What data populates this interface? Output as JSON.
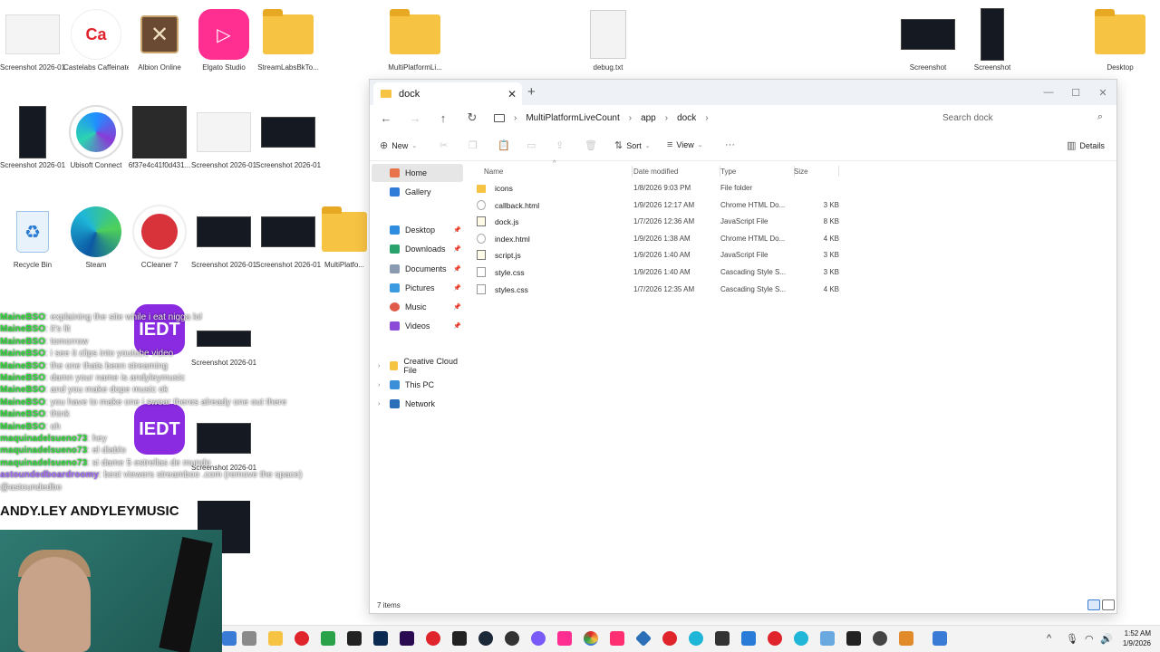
{
  "desktop": {
    "icons": [
      {
        "label": "Screenshot 2026-01 ...",
        "kind": "shot-light"
      },
      {
        "label": "Castelabs Caffeinated",
        "kind": "castelabs"
      },
      {
        "label": "Albion Online",
        "kind": "albion"
      },
      {
        "label": "Elgato Studio",
        "kind": "elgato"
      },
      {
        "label": "StreamLabsBkTo...",
        "kind": "folder"
      },
      {
        "label": "MultiPlatformLi...",
        "kind": "folder"
      },
      {
        "label": "debug.txt",
        "kind": "doc"
      },
      {
        "label": "Screenshot",
        "kind": "shot-dark"
      },
      {
        "label": "Screenshot",
        "kind": "shot-tall"
      },
      {
        "label": "Desktop",
        "kind": "folder"
      },
      {
        "label": "Screenshot 2026-01 ...",
        "kind": "shot-tall"
      },
      {
        "label": "Ubisoft Connect",
        "kind": "ubisoft"
      },
      {
        "label": "6f37e4c41f0d431...",
        "kind": "photo"
      },
      {
        "label": "Screenshot 2026-01 ...",
        "kind": "shot-light"
      },
      {
        "label": "Screenshot 2026-01 ...",
        "kind": "shot-dark"
      },
      {
        "label": "Recycle Bin",
        "kind": "recycle"
      },
      {
        "label": "Steam",
        "kind": "edge"
      },
      {
        "label": "CCleaner 7",
        "kind": "ccleaner"
      },
      {
        "label": "Screenshot 2026-01 ...",
        "kind": "shot-dark"
      },
      {
        "label": "Screenshot 2026-01 ...",
        "kind": "shot-dark"
      },
      {
        "label": "MultiPlatfo...",
        "kind": "folder"
      },
      {
        "label": "IEDT",
        "kind": "iedt"
      },
      {
        "label": "Screenshot 2026-01 ...",
        "kind": "shot-dark"
      },
      {
        "label": "IEDT",
        "kind": "iedt"
      },
      {
        "label": "Screenshot 2026-01 ...",
        "kind": "shot-dark"
      }
    ]
  },
  "chat": [
    {
      "user": "MaineBSO",
      "msg": "explaining the site while i eat nigga lol",
      "color": "green"
    },
    {
      "user": "MaineBSO",
      "msg": "it's lit",
      "color": "green"
    },
    {
      "user": "MaineBSO",
      "msg": "tomorrow",
      "color": "green"
    },
    {
      "user": "MaineBSO",
      "msg": "i see it clips into youtube video",
      "color": "green"
    },
    {
      "user": "MaineBSO",
      "msg": "the one thats been streaming",
      "color": "green"
    },
    {
      "user": "MaineBSO",
      "msg": "damn your name is andyleymusic",
      "color": "green"
    },
    {
      "user": "MaineBSO",
      "msg": "and you make dope music ok",
      "color": "green"
    },
    {
      "user": "MaineBSO",
      "msg": "you have to make one i swear theres already one out there",
      "color": "green"
    },
    {
      "user": "MaineBSO",
      "msg": "think",
      "color": "green"
    },
    {
      "user": "MaineBSO",
      "msg": "oh",
      "color": "green"
    },
    {
      "user": "maquinadelsueno73",
      "msg": "hey",
      "color": "green"
    },
    {
      "user": "maquinadelsueno73",
      "msg": "el diablo",
      "color": "green"
    },
    {
      "user": "maquinadelsueno73",
      "msg": "si dame 5 estrellas de mundo",
      "color": "green"
    },
    {
      "user": "astoundedboardroomy",
      "msg": "best viewers streamboo .com (remove the space)",
      "color": "purple"
    },
    {
      "user": "",
      "msg": "@astoundedbo",
      "color": "grey"
    }
  ],
  "promo": "ANDY.LEY   ANDYLEYMUSIC",
  "explorer": {
    "tab_title": "dock",
    "breadcrumb": [
      "MultiPlatformLiveCount",
      "app",
      "dock"
    ],
    "search_placeholder": "Search dock",
    "commands": {
      "new": "New",
      "sort": "Sort",
      "view": "View",
      "details": "Details"
    },
    "sidebar": {
      "home": "Home",
      "gallery": "Gallery",
      "quick": [
        "Desktop",
        "Downloads",
        "Documents",
        "Pictures",
        "Music",
        "Videos"
      ],
      "tree": [
        "Creative Cloud File",
        "This PC",
        "Network"
      ]
    },
    "columns": {
      "name": "Name",
      "date": "Date modified",
      "type": "Type",
      "size": "Size"
    },
    "files": [
      {
        "name": "icons",
        "date": "1/8/2026 9:03 PM",
        "type": "File folder",
        "size": "",
        "icon": "folder"
      },
      {
        "name": "callback.html",
        "date": "1/9/2026 12:17 AM",
        "type": "Chrome HTML Do...",
        "size": "3 KB",
        "icon": "html"
      },
      {
        "name": "dock.js",
        "date": "1/7/2026 12:36 AM",
        "type": "JavaScript File",
        "size": "8 KB",
        "icon": "js"
      },
      {
        "name": "index.html",
        "date": "1/9/2026 1:38 AM",
        "type": "Chrome HTML Do...",
        "size": "4 KB",
        "icon": "html"
      },
      {
        "name": "script.js",
        "date": "1/9/2026 1:40 AM",
        "type": "JavaScript File",
        "size": "3 KB",
        "icon": "js"
      },
      {
        "name": "style.css",
        "date": "1/9/2026 1:40 AM",
        "type": "Cascading Style S...",
        "size": "3 KB",
        "icon": "css"
      },
      {
        "name": "styles.css",
        "date": "1/7/2026 12:35 AM",
        "type": "Cascading Style S...",
        "size": "4 KB",
        "icon": "css"
      }
    ],
    "status": "7 items"
  },
  "taskbar": {
    "time": "1:52 AM",
    "date": "1/9/2026"
  },
  "colors": {
    "folder": "#f6c343",
    "chat_user_green": "#2fe03a",
    "chat_user_purple": "#a46bff",
    "selected_bg": "#e6e6e6"
  }
}
